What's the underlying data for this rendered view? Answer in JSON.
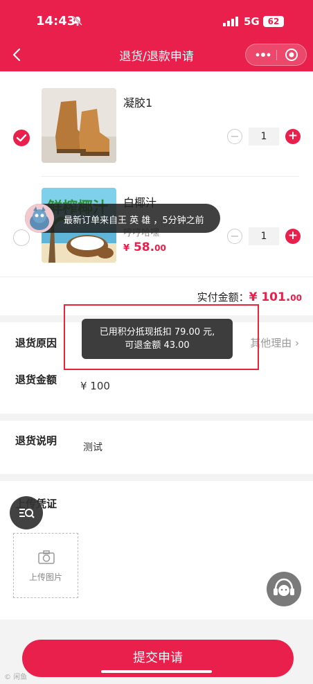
{
  "status_bar": {
    "time": "14:43",
    "network": "5G",
    "battery": "62"
  },
  "nav": {
    "title": "退货/退款申请"
  },
  "products": [
    {
      "name": "凝胶1",
      "spec": "",
      "price_int": "",
      "price_dec": "",
      "qty": "1",
      "selected": true
    },
    {
      "name": "白椰汁",
      "spec": "哼哼哈嘿",
      "price_int": "58.",
      "price_dec": "00",
      "qty": "1",
      "selected": false
    }
  ],
  "total": {
    "label": "实付金额：",
    "yen": "¥",
    "int": "101.",
    "dec": "00"
  },
  "recent_toast": {
    "text": "最新订单来自王 英 雄 ，5分钟之前"
  },
  "points_toast": {
    "line1": "已用积分抵现抵扣 79.00 元,",
    "line2": "可退金额 43.00"
  },
  "reason": {
    "label": "退货原因",
    "value": "其他理由 ›"
  },
  "refund": {
    "label": "退货金额",
    "value": "¥ 100"
  },
  "description": {
    "label": "退货说明",
    "value": "测试"
  },
  "proof": {
    "label": "上传凭证",
    "upload_label": "上传图片"
  },
  "submit": {
    "label": "提交申请"
  },
  "watermark": "© 闲鱼"
}
